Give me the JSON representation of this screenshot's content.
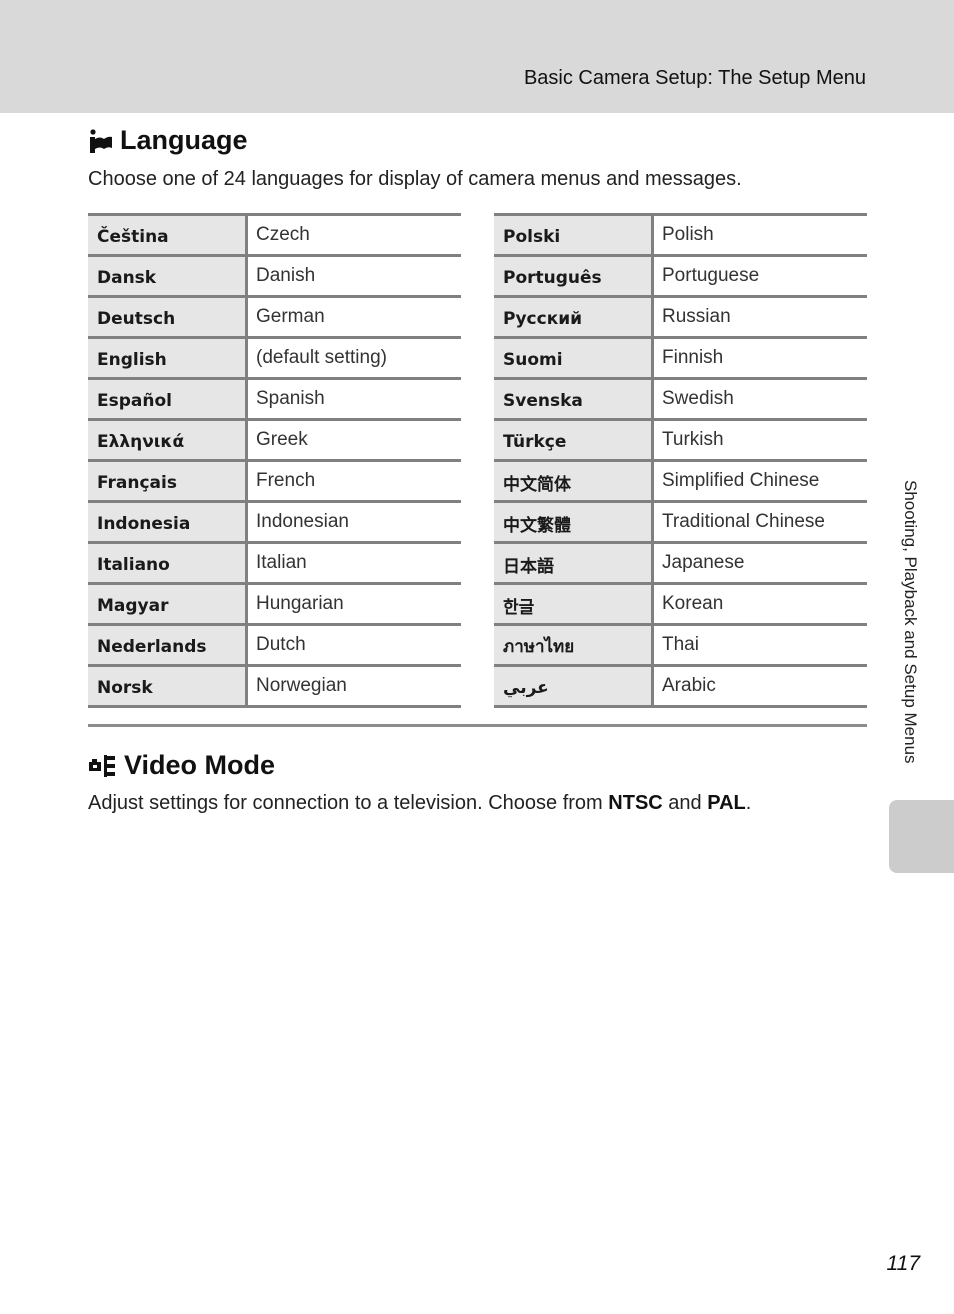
{
  "header": {
    "title": "Basic Camera Setup: The Setup Menu"
  },
  "language_section": {
    "icon": "language-icon",
    "title": "Language",
    "description": "Choose one of 24 languages for display of camera menus and messages.",
    "left_table": [
      {
        "native": "Čeština",
        "english": "Czech"
      },
      {
        "native": "Dansk",
        "english": "Danish"
      },
      {
        "native": "Deutsch",
        "english": "German"
      },
      {
        "native": "English",
        "english": "(default setting)"
      },
      {
        "native": "Español",
        "english": "Spanish"
      },
      {
        "native": "Ελληνικά",
        "english": "Greek"
      },
      {
        "native": "Français",
        "english": "French"
      },
      {
        "native": "Indonesia",
        "english": "Indonesian"
      },
      {
        "native": "Italiano",
        "english": "Italian"
      },
      {
        "native": "Magyar",
        "english": "Hungarian"
      },
      {
        "native": "Nederlands",
        "english": "Dutch"
      },
      {
        "native": "Norsk",
        "english": "Norwegian"
      }
    ],
    "right_table": [
      {
        "native": "Polski",
        "english": "Polish"
      },
      {
        "native": "Português",
        "english": "Portuguese"
      },
      {
        "native": "Русский",
        "english": "Russian"
      },
      {
        "native": "Suomi",
        "english": "Finnish"
      },
      {
        "native": "Svenska",
        "english": "Swedish"
      },
      {
        "native": "Türkçe",
        "english": "Turkish"
      },
      {
        "native": "中文简体",
        "english": "Simplified Chinese"
      },
      {
        "native": "中文繁體",
        "english": "Traditional Chinese"
      },
      {
        "native": "日本語",
        "english": "Japanese"
      },
      {
        "native": "한글",
        "english": "Korean"
      },
      {
        "native": "ภาษาไทย",
        "english": "Thai"
      },
      {
        "native": "عربي",
        "english": "Arabic"
      }
    ]
  },
  "video_section": {
    "icon": "video-mode-icon",
    "title": "Video Mode",
    "description_prefix": "Adjust settings for connection to a television. Choose from ",
    "option_1": "NTSC",
    "description_mid": " and ",
    "option_2": "PAL",
    "description_suffix": "."
  },
  "side_tab": {
    "label": "Shooting, Playback and Setup Menus"
  },
  "page_number": "117",
  "colors": {
    "header_band": "#d9d9d9",
    "table_rule": "#808080",
    "native_cell_bg": "#e6e6e6",
    "side_tab": "#cccccc"
  }
}
